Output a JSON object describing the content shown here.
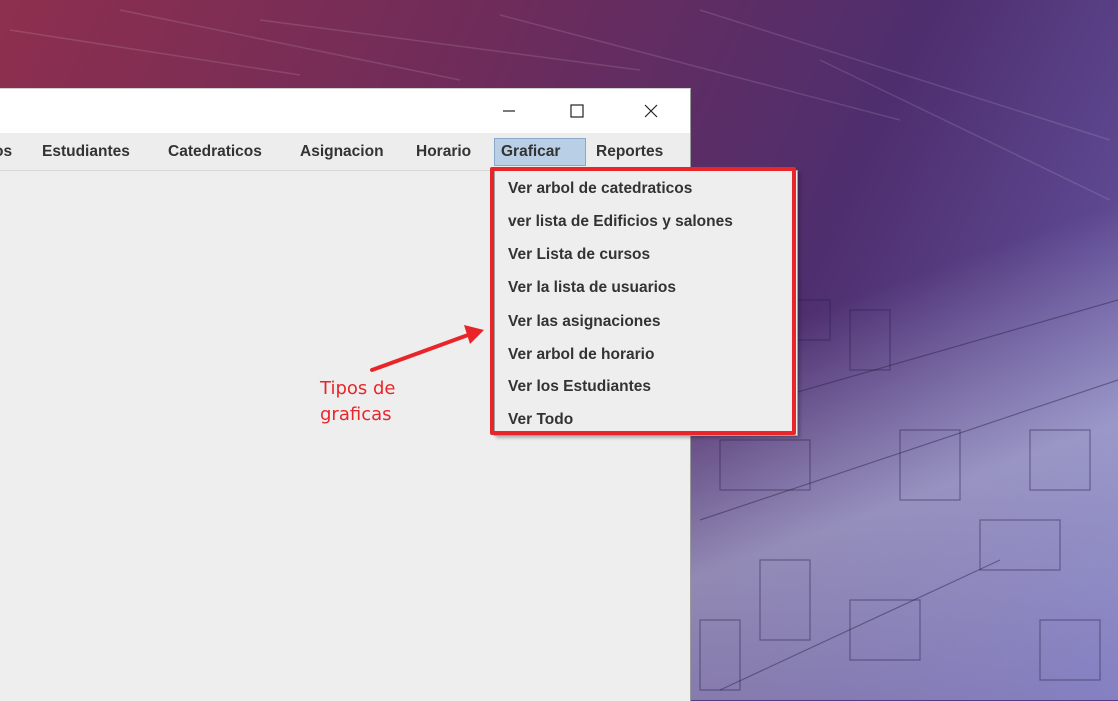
{
  "window": {
    "controls": {
      "minimize_icon": "minimize-icon",
      "maximize_icon": "maximize-icon",
      "close_icon": "close-icon"
    }
  },
  "menubar": {
    "items": [
      {
        "label": "os"
      },
      {
        "label": "Estudiantes"
      },
      {
        "label": "Catedraticos"
      },
      {
        "label": "Asignacion"
      },
      {
        "label": "Horario"
      },
      {
        "label": "Graficar",
        "active": true
      },
      {
        "label": "Reportes"
      }
    ]
  },
  "dropdown": {
    "items": [
      {
        "label": "Ver arbol de catedraticos"
      },
      {
        "label": "ver lista de Edificios y salones"
      },
      {
        "label": "Ver Lista de cursos"
      },
      {
        "label": "Ver la lista de usuarios"
      },
      {
        "label": "Ver las asignaciones"
      },
      {
        "label": "Ver arbol de horario"
      },
      {
        "label": "Ver los Estudiantes"
      },
      {
        "label": "Ver Todo"
      }
    ]
  },
  "annotation": {
    "line1": "Tipos de",
    "line2": "graficas",
    "color": "#e8262a"
  }
}
